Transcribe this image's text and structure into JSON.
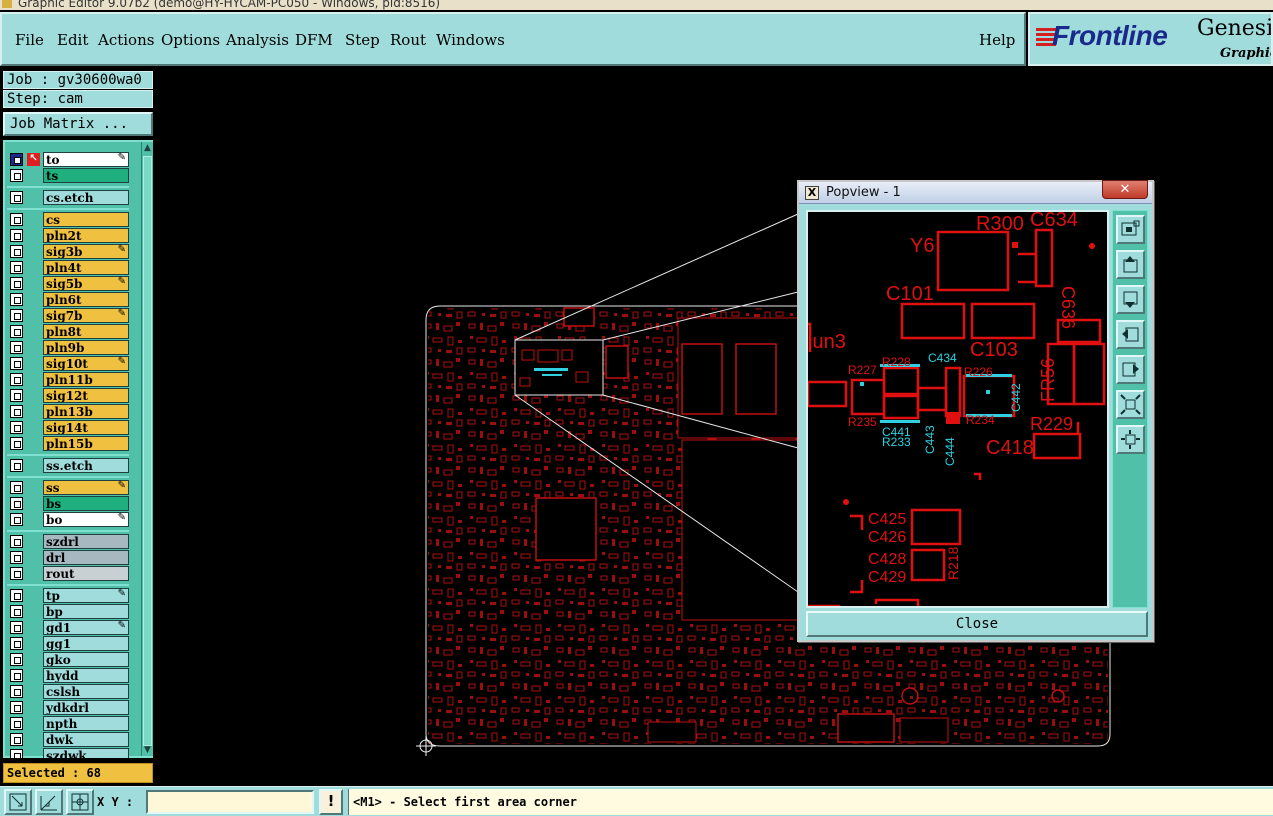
{
  "window": {
    "title": "Graphic Editor 9.07b2 (demo@HY-HYCAM-PC050 - Windows, pid:8516)"
  },
  "menu": {
    "items": [
      {
        "key": "file",
        "label": "File",
        "u": "F",
        "rest": "ile"
      },
      {
        "key": "edit",
        "label": "Edit",
        "u": "E",
        "rest": "dit"
      },
      {
        "key": "actions",
        "label": "Actions",
        "u": "A",
        "rest": "ctions"
      },
      {
        "key": "options",
        "label": "Options",
        "u": "O",
        "rest": "ptions"
      },
      {
        "key": "analysis",
        "label": "Analysis",
        "u": "",
        "rest": "Analysis"
      },
      {
        "key": "dfm",
        "label": "DFM",
        "u": "",
        "rest": "DFM"
      },
      {
        "key": "step",
        "label": "Step",
        "u": "S",
        "rest": "tep"
      },
      {
        "key": "rout",
        "label": "Rout",
        "u": "R",
        "rest": "out"
      },
      {
        "key": "windows",
        "label": "Windows",
        "u": "W",
        "rest": "indows"
      }
    ],
    "help": "Help"
  },
  "logo": {
    "brand": "Frontline",
    "product": "Genesis",
    "subtitle": "Graphic E"
  },
  "job": {
    "job_line": "Job : gv30600wa0",
    "step_line": "Step: cam",
    "matrix_button": "Job Matrix ..."
  },
  "layers": {
    "groups": [
      [
        {
          "name": "to",
          "color": "#ffffff",
          "active": true,
          "mark": "&#10006;"
        },
        {
          "name": "ts",
          "color": "#20b080",
          "mark": ""
        }
      ],
      [
        {
          "name": "cs.etch",
          "color": "#a0dcdc",
          "mark": ""
        }
      ],
      [
        {
          "name": "cs",
          "color": "#f0c040",
          "mark": ""
        },
        {
          "name": "pln2t",
          "color": "#f0c040",
          "mark": ""
        },
        {
          "name": "sig3b",
          "color": "#f0c040",
          "mark": "&#10006;"
        },
        {
          "name": "pln4t",
          "color": "#f0c040",
          "mark": ""
        },
        {
          "name": "sig5b",
          "color": "#f0c040",
          "mark": "&#10006;"
        },
        {
          "name": "pln6t",
          "color": "#f0c040",
          "mark": ""
        },
        {
          "name": "sig7b",
          "color": "#f0c040",
          "mark": "&#10006;"
        },
        {
          "name": "pln8t",
          "color": "#f0c040",
          "mark": ""
        },
        {
          "name": "pln9b",
          "color": "#f0c040",
          "mark": ""
        },
        {
          "name": "sig10t",
          "color": "#f0c040",
          "mark": "&#10006;"
        },
        {
          "name": "pln11b",
          "color": "#f0c040",
          "mark": ""
        },
        {
          "name": "sig12t",
          "color": "#f0c040",
          "mark": ""
        },
        {
          "name": "pln13b",
          "color": "#f0c040",
          "mark": ""
        },
        {
          "name": "sig14t",
          "color": "#f0c040",
          "mark": ""
        },
        {
          "name": "pln15b",
          "color": "#f0c040",
          "mark": ""
        }
      ],
      [
        {
          "name": "ss.etch",
          "color": "#a0dcdc",
          "mark": ""
        }
      ],
      [
        {
          "name": "ss",
          "color": "#f0c040",
          "mark": "&#10006;"
        },
        {
          "name": "bs",
          "color": "#20b080",
          "mark": ""
        },
        {
          "name": "bo",
          "color": "#ffffff",
          "mark": "&#10006;"
        }
      ],
      [
        {
          "name": "szdrl",
          "color": "#a8b8c0",
          "mark": ""
        },
        {
          "name": "drl",
          "color": "#a8b8c0",
          "mark": ""
        },
        {
          "name": "rout",
          "color": "#c8d0d4",
          "mark": ""
        }
      ],
      [
        {
          "name": "tp",
          "color": "#a0dcdc",
          "mark": "&#10006;"
        },
        {
          "name": "bp",
          "color": "#a0dcdc",
          "mark": ""
        },
        {
          "name": "gd1",
          "color": "#a0dcdc",
          "mark": "&#10006;"
        },
        {
          "name": "gg1",
          "color": "#a0dcdc",
          "mark": ""
        },
        {
          "name": "gko",
          "color": "#a0dcdc",
          "mark": ""
        },
        {
          "name": "hydd",
          "color": "#a0dcdc",
          "mark": ""
        },
        {
          "name": "cslsh",
          "color": "#a0dcdc",
          "mark": ""
        },
        {
          "name": "ydkdrl",
          "color": "#a0dcdc",
          "mark": ""
        },
        {
          "name": "npth",
          "color": "#a0dcdc",
          "mark": ""
        },
        {
          "name": "dwk",
          "color": "#a0dcdc",
          "mark": ""
        },
        {
          "name": "szdwk",
          "color": "#a0dcdc",
          "mark": ""
        }
      ]
    ]
  },
  "selected": "Selected : 68",
  "popview": {
    "title": "Popview - 1",
    "close_label": "Close",
    "refdes_red": [
      "R300",
      "C634",
      "Y6",
      "C636",
      "C101",
      "C103",
      "FR56",
      "lun3",
      "R227",
      "R228",
      "R226",
      "R235",
      "R234",
      "R229",
      "C418",
      "C425",
      "C426",
      "C428",
      "C429",
      "R218"
    ],
    "refdes_cyan": [
      "C434",
      "C441",
      "R233",
      "C443",
      "C444",
      "C442"
    ]
  },
  "status": {
    "xy_label": "X Y :",
    "xy_value": "",
    "warn": "!",
    "prompt": "<M1> - Select first area corner"
  },
  "colors": {
    "panel": "#a0dcdc",
    "copper": "#e01010",
    "highlight": "#20c8d8",
    "layer_signal": "#f0c040"
  }
}
